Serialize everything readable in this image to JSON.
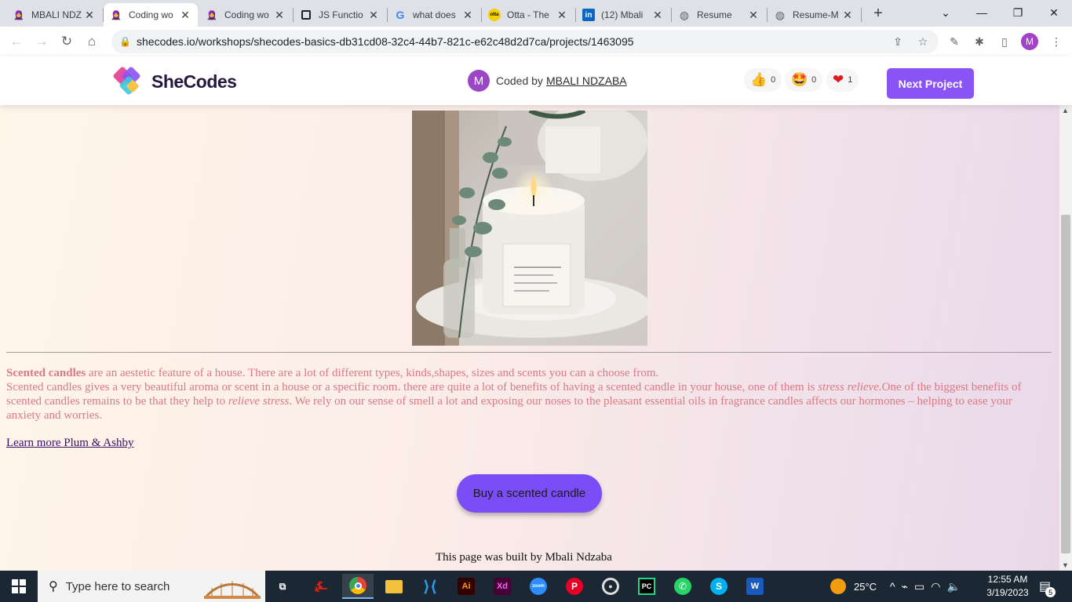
{
  "browser": {
    "tabs": [
      {
        "title": "MBALI NDZ",
        "favicon": "shecodes-icon"
      },
      {
        "title": "Coding wo",
        "favicon": "shecodes-icon",
        "active": true
      },
      {
        "title": "Coding wo",
        "favicon": "shecodes-icon"
      },
      {
        "title": "JS Functio",
        "favicon": "page-icon"
      },
      {
        "title": "what does",
        "favicon": "google-icon"
      },
      {
        "title": "Otta - The",
        "favicon": "otta-icon"
      },
      {
        "title": "(12) Mbali",
        "favicon": "linkedin-icon"
      },
      {
        "title": "Resume",
        "favicon": "globe-icon"
      },
      {
        "title": "Resume-M",
        "favicon": "globe-icon"
      }
    ],
    "url": "shecodes.io/workshops/shecodes-basics-db31cd08-32c4-44b7-821c-e62c48d2d7ca/projects/1463095",
    "profile_initial": "M"
  },
  "site_header": {
    "brand": "SheCodes",
    "coded_by_label": "Coded by",
    "author_initial": "M",
    "author": "MBALI NDZABA",
    "reactions": [
      {
        "icon": "thumbs-up-icon",
        "glyph": "👍",
        "count": "0"
      },
      {
        "icon": "star-struck-icon",
        "glyph": "🤩",
        "count": "0"
      },
      {
        "icon": "heart-icon",
        "glyph": "❤",
        "count": "1"
      }
    ],
    "next_button": "Next Project"
  },
  "content": {
    "para_bold": "Scented candles",
    "para_line1_rest": " are an aestetic feature of a house. There are a lot of different types, kinds,shapes, sizes and scents you can a choose from.",
    "para_line2_a": "Scented candles gives a very beautiful aroma or scent in a house or a specific room. there are quite a lot of benefits of having a scented candle in your house, one of them is ",
    "para_italic1": "stress relieve.",
    "para_line2_b": "One of the biggest benefits of scented candles remains to be that they help to ",
    "para_italic2": "relieve stress",
    "para_line2_c": ". We rely on our sense of smell a lot and exposing our noses to the pleasant essential oils in fragrance candles affects our hormones – helping to ease your anxiety and worries.",
    "learn_link": "Learn more Plum & Ashby",
    "buy_button": "Buy a scented candle",
    "footer": "This page was built by Mbali Ndzaba"
  },
  "taskbar": {
    "search_placeholder": "Type here to search",
    "weather": "25°C",
    "time": "12:55 AM",
    "date": "3/19/2023",
    "notification_count": "5",
    "apps": [
      "task-view-icon",
      "acrobat-icon",
      "chrome-icon",
      "file-explorer-icon",
      "vscode-icon",
      "illustrator-icon",
      "xd-icon",
      "zoom-icon",
      "pinterest-icon",
      "media-player-icon",
      "pycharm-icon",
      "whatsapp-icon",
      "skype-icon",
      "word-icon"
    ]
  },
  "colors": {
    "accent": "#8a53f5",
    "text_pink": "#d97a86",
    "taskbar": "#1b2733"
  }
}
